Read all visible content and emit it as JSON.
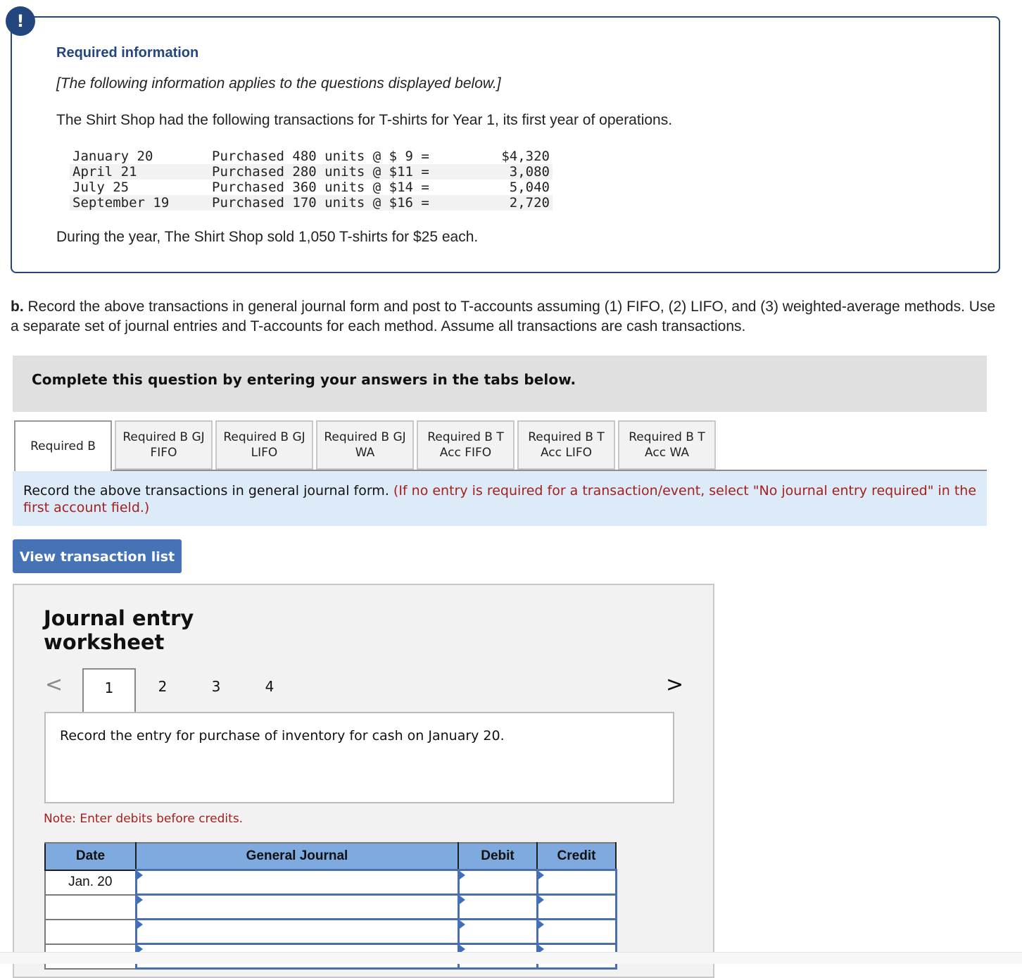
{
  "required_info": {
    "badge": "!",
    "title": "Required information",
    "italic_note": "[The following information applies to the questions displayed below.]",
    "intro": "The Shirt Shop had the following transactions for T-shirts for Year 1, its first year of operations.",
    "transactions": [
      {
        "date": "January 20",
        "desc": "Purchased 480 units @ $ 9 =",
        "amount": "$4,320"
      },
      {
        "date": "April 21",
        "desc": "Purchased 280 units @ $11 =",
        "amount": "3,080"
      },
      {
        "date": "July 25",
        "desc": "Purchased 360 units @ $14 =",
        "amount": "5,040"
      },
      {
        "date": "September 19",
        "desc": "Purchased 170 units @ $16 =",
        "amount": "2,720"
      }
    ],
    "sold_note": "During the year, The Shirt Shop sold 1,050 T-shirts for $25 each."
  },
  "question": {
    "label": "b.",
    "text": " Record the above transactions in general journal form and post to T-accounts assuming (1) FIFO, (2) LIFO, and (3) weighted-average methods. Use a separate set of journal entries and T-accounts for each method. Assume all transactions are cash transactions."
  },
  "banner": "Complete this question by entering your answers in the tabs below.",
  "tabs": [
    {
      "label": "Required B",
      "active": true
    },
    {
      "label": "Required B GJ\nFIFO",
      "active": false
    },
    {
      "label": "Required B GJ\nLIFO",
      "active": false
    },
    {
      "label": "Required B GJ\nWA",
      "active": false
    },
    {
      "label": "Required B T\nAcc FIFO",
      "active": false
    },
    {
      "label": "Required B T\nAcc LIFO",
      "active": false
    },
    {
      "label": "Required B T\nAcc WA",
      "active": false
    }
  ],
  "instruction": {
    "main": "Record the above transactions in general journal form. ",
    "red": "(If no entry is required for a transaction/event, select \"No journal entry required\" in the first account field.)"
  },
  "view_button": "View transaction list",
  "worksheet": {
    "title": "Journal entry\nworksheet",
    "prev_icon": "<",
    "next_icon": ">",
    "pages": [
      "1",
      "2",
      "3",
      "4"
    ],
    "active_page": "1",
    "prompt": "Record the entry for purchase of inventory for cash on January 20.",
    "note": "Note: Enter debits before credits.",
    "table": {
      "headers": [
        "Date",
        "General Journal",
        "Debit",
        "Credit"
      ],
      "rows": [
        {
          "date": "Jan. 20",
          "account": "",
          "debit": "",
          "credit": ""
        },
        {
          "date": "",
          "account": "",
          "debit": "",
          "credit": ""
        },
        {
          "date": "",
          "account": "",
          "debit": "",
          "credit": ""
        },
        {
          "date": "",
          "account": "",
          "debit": "",
          "credit": ""
        }
      ]
    }
  }
}
